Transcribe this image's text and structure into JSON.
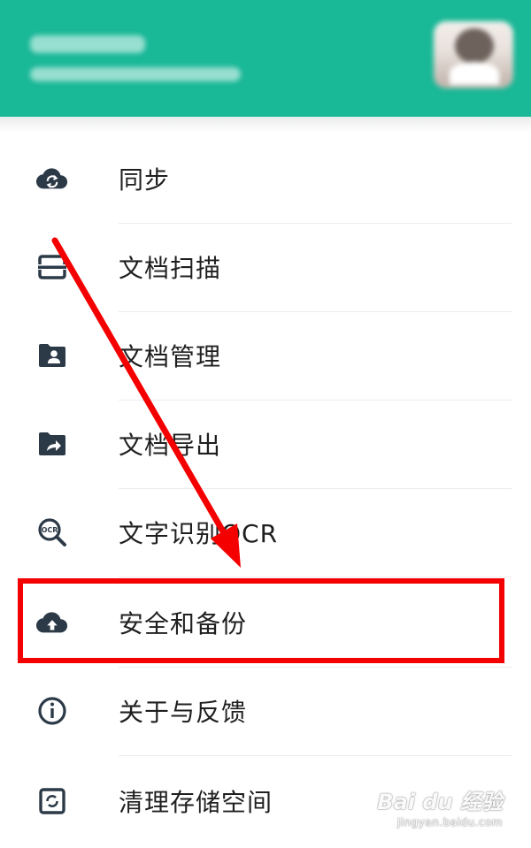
{
  "colors": {
    "header_bg": "#19b897",
    "icon_color": "#2c3a47",
    "highlight_red": "#f40000"
  },
  "menu": {
    "items": [
      {
        "label": "同步",
        "icon": "cloud-sync-icon"
      },
      {
        "label": "文档扫描",
        "icon": "scan-icon"
      },
      {
        "label": "文档管理",
        "icon": "folder-person-icon"
      },
      {
        "label": "文档导出",
        "icon": "folder-share-icon"
      },
      {
        "label": "文字识别OCR",
        "icon": "ocr-search-icon"
      },
      {
        "label": "安全和备份",
        "icon": "cloud-upload-icon"
      },
      {
        "label": "关于与反馈",
        "icon": "info-icon"
      },
      {
        "label": "清理存储空间",
        "icon": "cleanup-icon"
      }
    ]
  },
  "watermark": {
    "logo": "Bai du 经验",
    "url": "jingyan.baidu.com"
  }
}
